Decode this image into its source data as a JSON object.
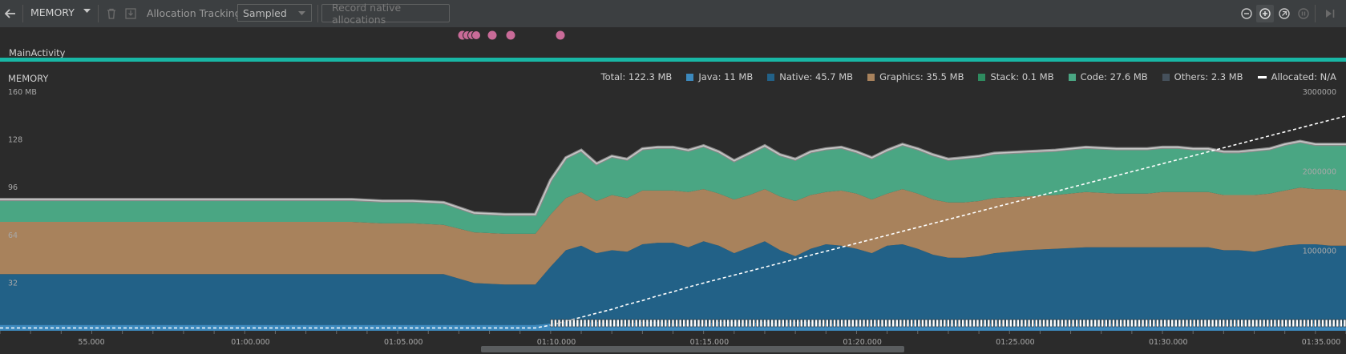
{
  "toolbar": {
    "back_icon": "arrow-left-icon",
    "profiler_selector": "MEMORY",
    "dropdown_icon": "caret-down-icon",
    "gc_icon": "trash-icon",
    "heap_dump_icon": "heap-dump-icon",
    "allocation_label": "Allocation Tracking",
    "allocation_mode": "Sampled",
    "record_native_label": "Record native allocations",
    "right_icons": [
      "zoom-out-icon",
      "zoom-in-icon",
      "reset-zoom-icon",
      "pause-icon",
      "go-live-icon"
    ]
  },
  "events": {
    "activity_label": "MainActivity",
    "activity_color": "#18b7a5",
    "marker_color": "#c96b98"
  },
  "memory": {
    "title": "MEMORY",
    "legend": {
      "total": "Total: 122.3 MB",
      "java": "Java: 11 MB",
      "native": "Native: 45.7 MB",
      "graphics": "Graphics: 35.5 MB",
      "stack": "Stack: 0.1 MB",
      "code": "Code: 27.6 MB",
      "others": "Others: 2.3 MB",
      "allocated": "Allocated: N/A"
    },
    "colors": {
      "java": "#3c89bd",
      "native": "#226187",
      "graphics": "#a8825c",
      "stack": "#2e8b5f",
      "code": "#4aa683",
      "others": "#45505b",
      "total_line": "#c8c8c8",
      "allocated_line": "#ffffff"
    }
  },
  "chart_data": {
    "type": "area",
    "x_ticks": [
      "55.000",
      "01:00.000",
      "01:05.000",
      "01:10.000",
      "01:15.000",
      "01:20.000",
      "01:25.000",
      "01:30.000",
      "01:35.000"
    ],
    "y_left_ticks": [
      "160 MB",
      "128",
      "96",
      "64",
      "32"
    ],
    "y_right_ticks": [
      "3000000",
      "2000000",
      "1000000"
    ],
    "ylim_left": [
      0,
      160
    ],
    "ylim_right": [
      0,
      3000000
    ],
    "x": [
      52.5,
      54,
      56,
      58,
      60,
      62,
      64,
      65,
      66,
      67,
      68,
      69,
      70,
      70.5,
      71,
      71.5,
      72,
      72.5,
      73,
      73.5,
      74,
      74.5,
      75,
      75.5,
      76,
      76.5,
      77,
      77.5,
      78,
      78.5,
      79,
      79.5,
      80,
      80.5,
      81,
      81.5,
      82,
      82.5,
      83,
      83.5,
      84,
      84.5,
      85,
      86,
      87,
      88,
      89,
      90,
      90.5,
      91,
      91.5,
      92,
      92.5,
      93,
      93.5,
      94,
      94.5,
      95,
      95.5,
      96,
      96.5
    ],
    "series": [
      {
        "name": "Java",
        "values": [
          4,
          4,
          4,
          4,
          4,
          4,
          4,
          4,
          4,
          4,
          4,
          4,
          4,
          5,
          6,
          5,
          6,
          5,
          5,
          6,
          6,
          5,
          5,
          5,
          6,
          6,
          5,
          6,
          5,
          6,
          6,
          5,
          5,
          5,
          5,
          5,
          5,
          5,
          5,
          5,
          5,
          5,
          5,
          5,
          5,
          5,
          5,
          5,
          5,
          5,
          5,
          5,
          5,
          5,
          5,
          5,
          5,
          5,
          5,
          5,
          5
        ]
      },
      {
        "name": "Native",
        "values": [
          34,
          34,
          34,
          34,
          34,
          34,
          34,
          34,
          34,
          34,
          28,
          27,
          27,
          38,
          48,
          52,
          46,
          49,
          48,
          52,
          53,
          54,
          51,
          55,
          51,
          46,
          51,
          54,
          49,
          44,
          49,
          53,
          52,
          50,
          47,
          52,
          53,
          50,
          46,
          44,
          44,
          45,
          47,
          49,
          50,
          51,
          51,
          51,
          51,
          51,
          51,
          51,
          49,
          49,
          48,
          50,
          52,
          53,
          53,
          52,
          52
        ]
      },
      {
        "name": "Graphics",
        "values": [
          35,
          35,
          35,
          35,
          35,
          35,
          35,
          34,
          34,
          33,
          34,
          34,
          34,
          35,
          35,
          36,
          35,
          37,
          36,
          36,
          35,
          35,
          37,
          35,
          35,
          36,
          35,
          35,
          36,
          37,
          36,
          35,
          37,
          37,
          36,
          35,
          37,
          37,
          37,
          37,
          37,
          37,
          37,
          36,
          36,
          37,
          36,
          36,
          37,
          37,
          37,
          37,
          37,
          37,
          38,
          37,
          37,
          38,
          37,
          38,
          37
        ]
      },
      {
        "name": "Code",
        "values": [
          15,
          15,
          15,
          15,
          15,
          15,
          15,
          15,
          15,
          15,
          13,
          13,
          13,
          23,
          27,
          28,
          25,
          26,
          26,
          28,
          29,
          29,
          28,
          29,
          28,
          26,
          28,
          29,
          28,
          28,
          29,
          29,
          29,
          28,
          28,
          29,
          30,
          30,
          30,
          29,
          30,
          30,
          30,
          30,
          30,
          30,
          30,
          30,
          30,
          30,
          29,
          29,
          29,
          29,
          30,
          30,
          31,
          31,
          30,
          30,
          31
        ]
      },
      {
        "name": "Allocated",
        "values": [
          35000,
          35000,
          35000,
          35000,
          35000,
          35000,
          35000,
          35000,
          35000,
          35000,
          35000,
          35000,
          35000,
          70000,
          120000,
          170000,
          220000,
          270000,
          330000,
          380000,
          440000,
          490000,
          550000,
          600000,
          650000,
          700000,
          750000,
          800000,
          850000,
          900000,
          950000,
          1000000,
          1050000,
          1100000,
          1150000,
          1200000,
          1250000,
          1300000,
          1350000,
          1400000,
          1450000,
          1500000,
          1550000,
          1650000,
          1750000,
          1850000,
          1950000,
          2050000,
          2100000,
          2150000,
          2200000,
          2250000,
          2300000,
          2350000,
          2400000,
          2450000,
          2500000,
          2550000,
          2600000,
          2650000,
          2700000
        ]
      }
    ]
  }
}
